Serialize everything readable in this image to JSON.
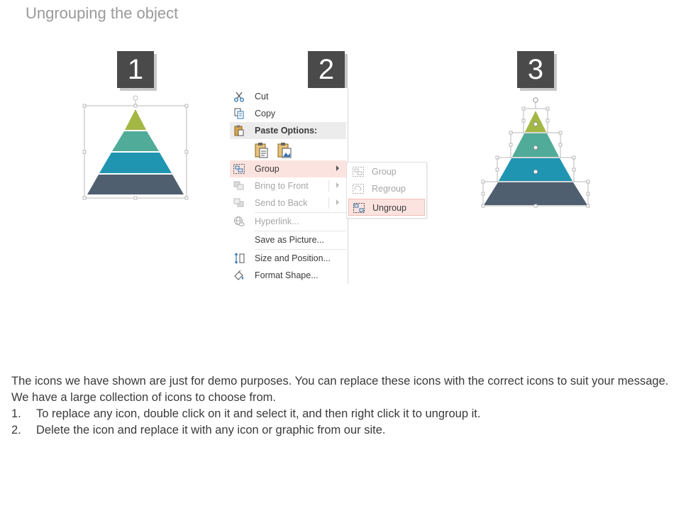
{
  "title": "Ungrouping the object",
  "steps": [
    "1",
    "2",
    "3"
  ],
  "colors": {
    "tier1": "#a3b745",
    "tier2": "#50ab98",
    "tier3": "#1f95b2",
    "tier4": "#4f5f70",
    "highlight": "#fbe3df",
    "step_box": "#4a4a4a"
  },
  "context_menu": {
    "items": [
      {
        "label": "Cut",
        "icon": "scissors-icon",
        "disabled": false
      },
      {
        "label": "Copy",
        "icon": "copy-icon",
        "disabled": false
      },
      {
        "label": "Paste Options:",
        "icon": "paste-icon",
        "disabled": false
      },
      {
        "label": "Group",
        "icon": "group-icon",
        "disabled": false,
        "submenu": true
      },
      {
        "label": "Bring to Front",
        "icon": "bring-to-front-icon",
        "disabled": true,
        "submenu": true
      },
      {
        "label": "Send to Back",
        "icon": "send-to-back-icon",
        "disabled": true,
        "submenu": true
      },
      {
        "label": "Hyperlink...",
        "icon": "hyperlink-icon",
        "disabled": true
      },
      {
        "label": "Save as Picture...",
        "icon": "",
        "disabled": false
      },
      {
        "label": "Size and Position...",
        "icon": "size-position-icon",
        "disabled": false
      },
      {
        "label": "Format Shape...",
        "icon": "format-shape-icon",
        "disabled": false
      }
    ],
    "submenu": [
      {
        "label": "Group",
        "icon": "group-icon",
        "disabled": true
      },
      {
        "label": "Regroup",
        "icon": "regroup-icon",
        "disabled": true
      },
      {
        "label": "Ungroup",
        "icon": "ungroup-icon",
        "disabled": false
      }
    ]
  },
  "description": {
    "intro": "The icons we have shown are just for demo purposes. You can replace these icons with the correct icons to suit your message. We have a large collection of icons to choose from.",
    "items": [
      {
        "num": "1.",
        "text": "To replace any icon, double click on it and select it, and then right click it to ungroup it."
      },
      {
        "num": "2.",
        "text": "Delete the icon and replace it with any icon or graphic from our site."
      }
    ]
  }
}
